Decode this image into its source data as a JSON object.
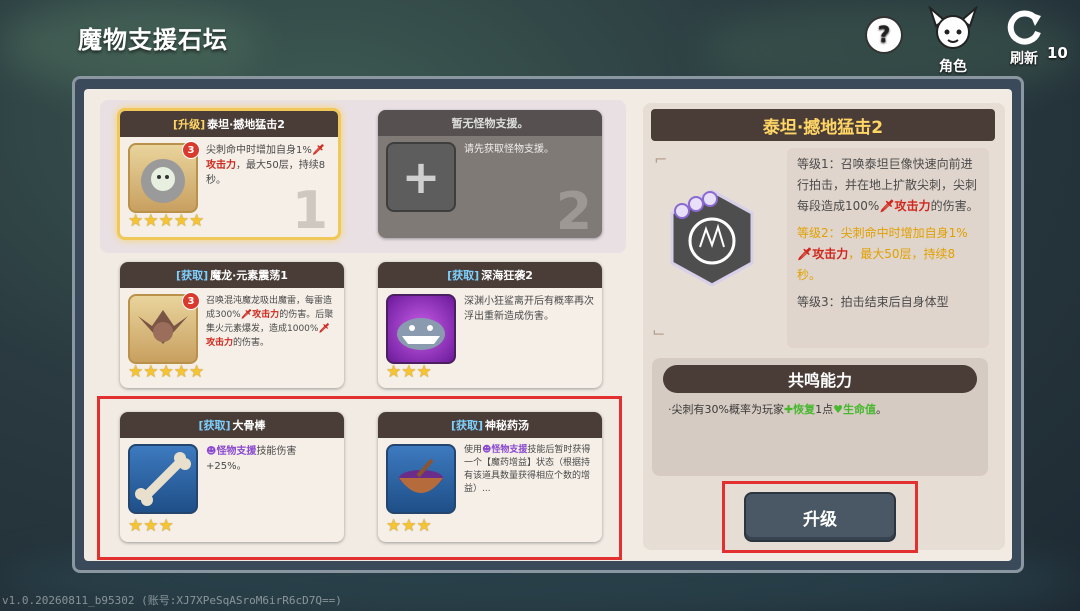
{
  "header": {
    "title": "魔物支援石坛",
    "help_label": "?",
    "role_label": "角色",
    "refresh_label": "刷新",
    "refresh_count": "10"
  },
  "slots": [
    {
      "tag": "[升级]",
      "name": "泰坦·撼地猛击2",
      "level": "3",
      "desc_parts": [
        "尖刺命中时增加自身1%",
        "攻击力",
        "，最大50层，持续8秒。"
      ],
      "stars": "★★★★★",
      "slot_number": "1"
    },
    {
      "tag": "",
      "name": "暂无怪物支援。",
      "desc": "请先获取怪物支援。",
      "plus": "+",
      "slot_number": "2"
    }
  ],
  "cards": [
    {
      "tag": "[获取]",
      "name": "魔龙·元素震荡1",
      "level": "3",
      "desc_parts": [
        "召唤混沌魔龙吸出魔雷，每雷造成300%",
        "攻击力",
        "的伤害。后聚集火元素爆发，造成1000%",
        "攻击力",
        "的伤害。"
      ],
      "stars": "★★★★★"
    },
    {
      "tag": "[获取]",
      "name": "深海狂袭2",
      "desc": "深渊小狂鲨离开后有概率再次浮出重新造成伤害。",
      "stars": "★★★"
    },
    {
      "tag": "[获取]",
      "name": "大骨棒",
      "desc_parts": [
        "怪物支援",
        "技能伤害+25%。"
      ],
      "stars": "★★★"
    },
    {
      "tag": "[获取]",
      "name": "神秘药汤",
      "desc_parts": [
        "使用",
        "怪物支援",
        "技能后暂时获得一个【魔药增益】状态（根据持有该道具数量获得相应个数的增益）..."
      ],
      "stars": "★★★"
    }
  ],
  "detail": {
    "title": "泰坦·撼地猛击2",
    "lv1": "等级1：召唤泰坦巨像快速向前进行拍击，并在地上扩散尖刺，尖刺每段造成100%",
    "lv1_red": "攻击力",
    "lv1_end": "的伤害。",
    "lv2": "等级2：尖刺命中时增加自身1%",
    "lv2_red": "攻击力",
    "lv2_end": "，最大50层，持续8秒。",
    "lv3": "等级3：拍击结束后自身体型"
  },
  "resonance": {
    "title": "共鸣能力",
    "text_a": "·尖刺有30%概率为玩家",
    "heal": "恢复",
    "text_b": "1点",
    "hp": "生命值",
    "text_c": "。"
  },
  "upgrade_button": "升级",
  "version": "v1.0.20260811_b95302 (账号:XJ7XPeSqASroM6irR6cD7Q==)",
  "colors": {
    "accent_gold": "#f0c85a",
    "header_brown": "#4a3d38",
    "highlight_red": "#e23030"
  }
}
